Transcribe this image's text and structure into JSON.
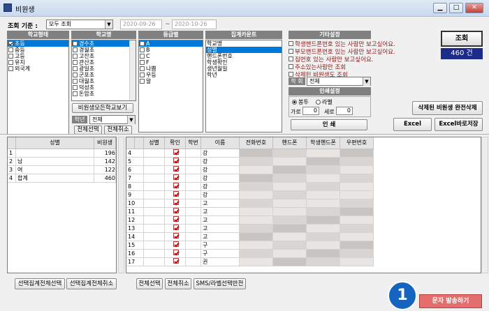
{
  "window": {
    "title": "비원생"
  },
  "filter": {
    "label": "조회 기준 :",
    "value": "모두 조회",
    "date_from": "2020-09-26",
    "tilde": "~",
    "date_to": "2020-10-26"
  },
  "lists": {
    "school_type": {
      "header": "학교형태",
      "items": [
        "초등",
        "중등",
        "고등",
        "유치",
        "외국계"
      ],
      "checked": [
        0
      ]
    },
    "school_name": {
      "header": "학교명",
      "items": [
        "경수초",
        "경월초",
        "고잔초",
        "관산초",
        "광일초",
        "군포초",
        "대월초",
        "덕성초",
        "돈암초"
      ]
    },
    "grade": {
      "header": "등급별",
      "items": [
        "A",
        "B",
        "C",
        "F",
        "나쁨",
        "우등",
        "알"
      ]
    },
    "summary": {
      "header": "집계카운트",
      "items": [
        "학교명",
        "성별",
        "핸드폰번호",
        "학생확인",
        "생년월일",
        "학년"
      ]
    }
  },
  "other": {
    "header": "기타설정",
    "options": [
      "학생핸드폰번호 있는 사람만 보고싶어요.",
      "부모핸드폰번호 있는 사람만 보고싶어요.",
      "집번호 있는 사람만 보고싶어요.",
      "주소있는사람만 조회",
      "삭제된 비원생도 조회"
    ],
    "grade_label": "학 회",
    "grade_value": "전체",
    "print_header": "인쇄설정",
    "env_label": "봉투",
    "label_label": "라벨",
    "row_label": "가로",
    "row_value": "0",
    "col_label": "세로",
    "col_value": "0",
    "print_button": "인 쇄"
  },
  "buttons": {
    "view_all_schools": "비원생모든학교보기",
    "grade_label": "학년",
    "grade_value": "전체",
    "select_all": "전체선택",
    "deselect_all": "전체취소",
    "search": "조회",
    "count": "460 건",
    "perm_delete": "삭제된 비원생 완전삭제",
    "excel": "Excel",
    "excel_save": "Excel바로저장"
  },
  "left_grid": {
    "columns": [
      "",
      "성별",
      "비원생"
    ],
    "rows": [
      [
        "1",
        "",
        "196"
      ],
      [
        "2",
        "남",
        "142"
      ],
      [
        "3",
        "여",
        "122"
      ],
      [
        "4",
        "합계",
        "460"
      ]
    ]
  },
  "main_grid": {
    "columns": [
      "",
      "",
      "성별",
      "확인",
      "학번",
      "이름",
      "전화번호",
      "핸드폰",
      "학생핸드폰",
      "우편번호"
    ],
    "rows": [
      {
        "no": "4",
        "name": "강"
      },
      {
        "no": "5",
        "name": "강"
      },
      {
        "no": "6",
        "name": "강"
      },
      {
        "no": "7",
        "name": "강"
      },
      {
        "no": "8",
        "name": "강"
      },
      {
        "no": "9",
        "name": "강"
      },
      {
        "no": "10",
        "name": "고"
      },
      {
        "no": "11",
        "name": "고"
      },
      {
        "no": "12",
        "name": "고"
      },
      {
        "no": "13",
        "name": "고"
      },
      {
        "no": "14",
        "name": "고"
      },
      {
        "no": "15",
        "name": "구"
      },
      {
        "no": "16",
        "name": "구"
      },
      {
        "no": "17",
        "name": "권"
      }
    ]
  },
  "bottom": {
    "sel_summary_all": "선택집계전체선택",
    "sel_summary_cancel": "선택집계전체취소",
    "select_all": "전체선택",
    "cancel_all": "전체취소",
    "sms_toggle": "SMS/라벨선택반전",
    "send_sms": "문자 발송하기",
    "badge": "1"
  },
  "colors": {
    "accent": "#0078d7",
    "badge": "#1565c0",
    "option_red": "#8b1a1a",
    "send_button": "#e46e6e"
  }
}
